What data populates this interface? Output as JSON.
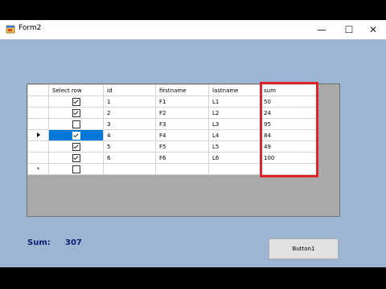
{
  "window": {
    "title": "Form2"
  },
  "title_controls": {
    "minimize": "—",
    "maximize": "☐",
    "close": "✕"
  },
  "grid": {
    "columns": [
      "Select row",
      "id",
      "firstname",
      "lastname",
      "sum"
    ],
    "rows": [
      {
        "checked": true,
        "id": "1",
        "firstname": "F1",
        "lastname": "L1",
        "sum": "50"
      },
      {
        "checked": true,
        "id": "2",
        "firstname": "F2",
        "lastname": "L2",
        "sum": "24"
      },
      {
        "checked": false,
        "id": "3",
        "firstname": "F3",
        "lastname": "L3",
        "sum": "95"
      },
      {
        "checked": true,
        "id": "4",
        "firstname": "F4",
        "lastname": "L4",
        "sum": "84",
        "current": true
      },
      {
        "checked": true,
        "id": "5",
        "firstname": "F5",
        "lastname": "L5",
        "sum": "49"
      },
      {
        "checked": true,
        "id": "6",
        "firstname": "F6",
        "lastname": "L6",
        "sum": "100"
      }
    ],
    "new_row_marker": "*"
  },
  "footer": {
    "sum_label": "Sum:",
    "sum_value": "307",
    "button_label": "Button1"
  },
  "colors": {
    "form_bg": "#9bb5d3",
    "selection": "#0078d7",
    "highlight_box": "#e0242b",
    "sum_text": "#0a1f73"
  }
}
